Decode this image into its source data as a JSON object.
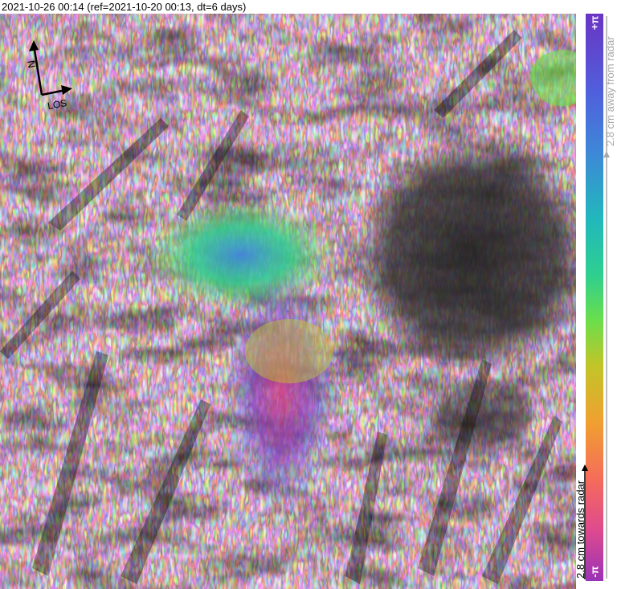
{
  "title": "2021-10-26 00:14 (ref=2021-10-20 00:13, dt=6 days)",
  "compass": {
    "north_label": "N",
    "track_label": "LOS",
    "north_alt": "N"
  },
  "colorbar": {
    "top_label": "+π",
    "bottom_label": "-π",
    "away_text": "2.8 cm away from radar",
    "towards_text": "2.8 cm towards radar",
    "away_color": "#a8a8a8",
    "towards_color": "#000000"
  }
}
